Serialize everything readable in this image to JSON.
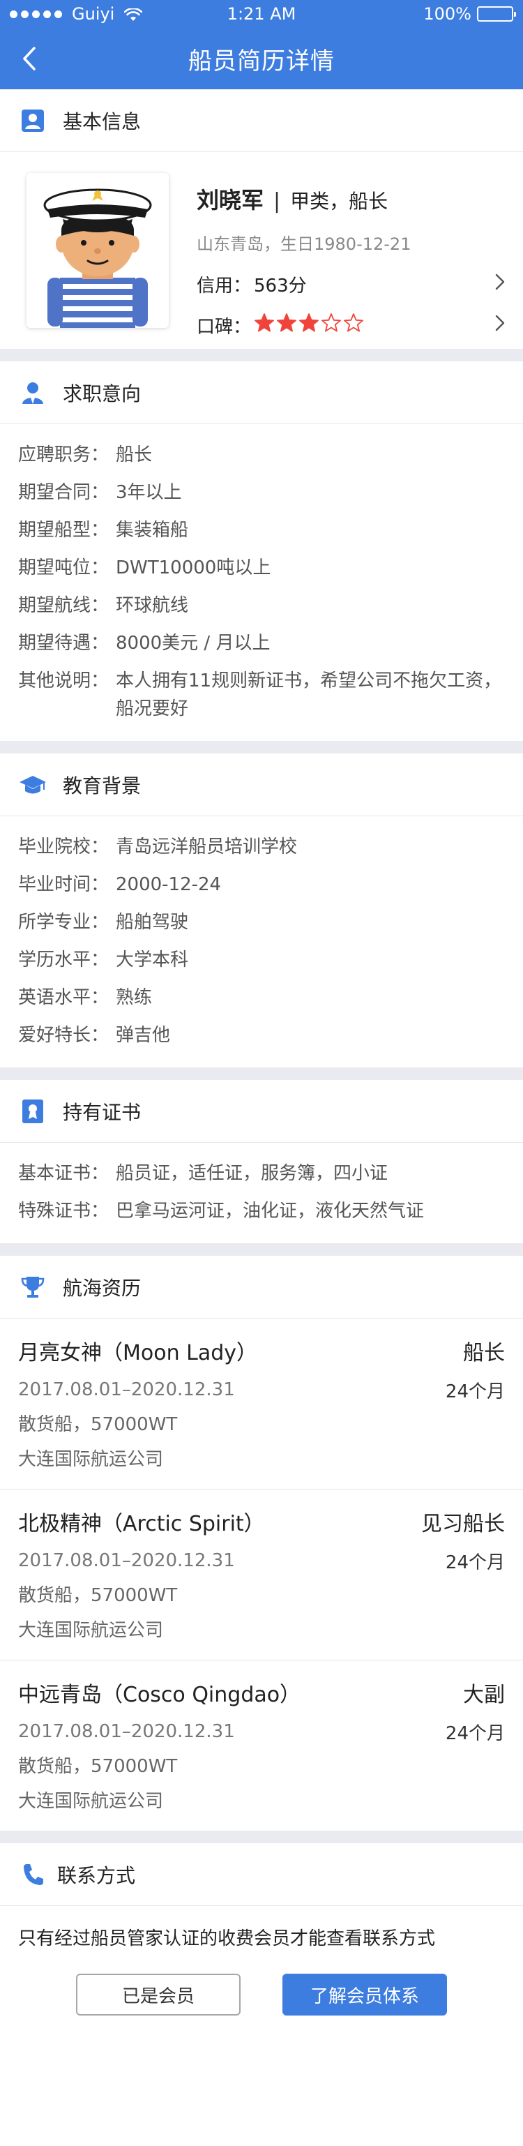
{
  "statusbar": {
    "carrier": "Guiyi",
    "time": "1:21 AM",
    "battery": "100%",
    "battery_level": 1.0
  },
  "nav": {
    "title": "船员简历详情"
  },
  "basic": {
    "title": "基本信息",
    "name": "刘晓军",
    "separator": "|",
    "role": "甲类，船长",
    "sub": "山东青岛，生日1980-12-21",
    "credit_label": "信用：",
    "credit_value": "563分",
    "reputation_label": "口碑：",
    "reputation_rating": 3,
    "reputation_max": 5
  },
  "job": {
    "title": "求职意向",
    "rows": [
      {
        "k": "应聘职务：",
        "v": "船长"
      },
      {
        "k": "期望合同：",
        "v": "3年以上"
      },
      {
        "k": "期望船型：",
        "v": "集装箱船"
      },
      {
        "k": "期望吨位：",
        "v": "DWT10000吨以上"
      },
      {
        "k": "期望航线：",
        "v": "环球航线"
      },
      {
        "k": "期望待遇：",
        "v": "8000美元 / 月以上"
      },
      {
        "k": "其他说明：",
        "v": "本人拥有11规则新证书，希望公司不拖欠工资，船况要好"
      }
    ]
  },
  "edu": {
    "title": "教育背景",
    "rows": [
      {
        "k": "毕业院校：",
        "v": "青岛远洋船员培训学校"
      },
      {
        "k": "毕业时间：",
        "v": "2000-12-24"
      },
      {
        "k": "所学专业：",
        "v": "船舶驾驶"
      },
      {
        "k": "学历水平：",
        "v": "大学本科"
      },
      {
        "k": "英语水平：",
        "v": "熟练"
      },
      {
        "k": "爱好特长：",
        "v": "弹吉他"
      }
    ]
  },
  "cert": {
    "title": "持有证书",
    "rows": [
      {
        "k": "基本证书：",
        "v": "船员证，适任证，服务簿，四小证"
      },
      {
        "k": "特殊证书：",
        "v": "巴拿马运河证，油化证，液化天然气证"
      }
    ]
  },
  "sea": {
    "title": "航海资历",
    "items": [
      {
        "ship": "月亮女神（Moon Lady）",
        "position": "船长",
        "period": "2017.08.01–2020.12.31",
        "duration": "24个月",
        "type": "散货船，57000WT",
        "company": "大连国际航运公司"
      },
      {
        "ship": "北极精神（Arctic Spirit）",
        "position": "见习船长",
        "period": "2017.08.01–2020.12.31",
        "duration": "24个月",
        "type": "散货船，57000WT",
        "company": "大连国际航运公司"
      },
      {
        "ship": "中远青岛（Cosco Qingdao）",
        "position": "大副",
        "period": "2017.08.01–2020.12.31",
        "duration": "24个月",
        "type": "散货船，57000WT",
        "company": "大连国际航运公司"
      }
    ]
  },
  "contact": {
    "title": "联系方式",
    "note": "只有经过船员管家认证的收费会员才能查看联系方式",
    "member_button": "已是会员",
    "learn_button": "了解会员体系"
  },
  "colors": {
    "brand": "#3d7de0",
    "star": "#f0443b",
    "divider": "#e9ebf1"
  }
}
